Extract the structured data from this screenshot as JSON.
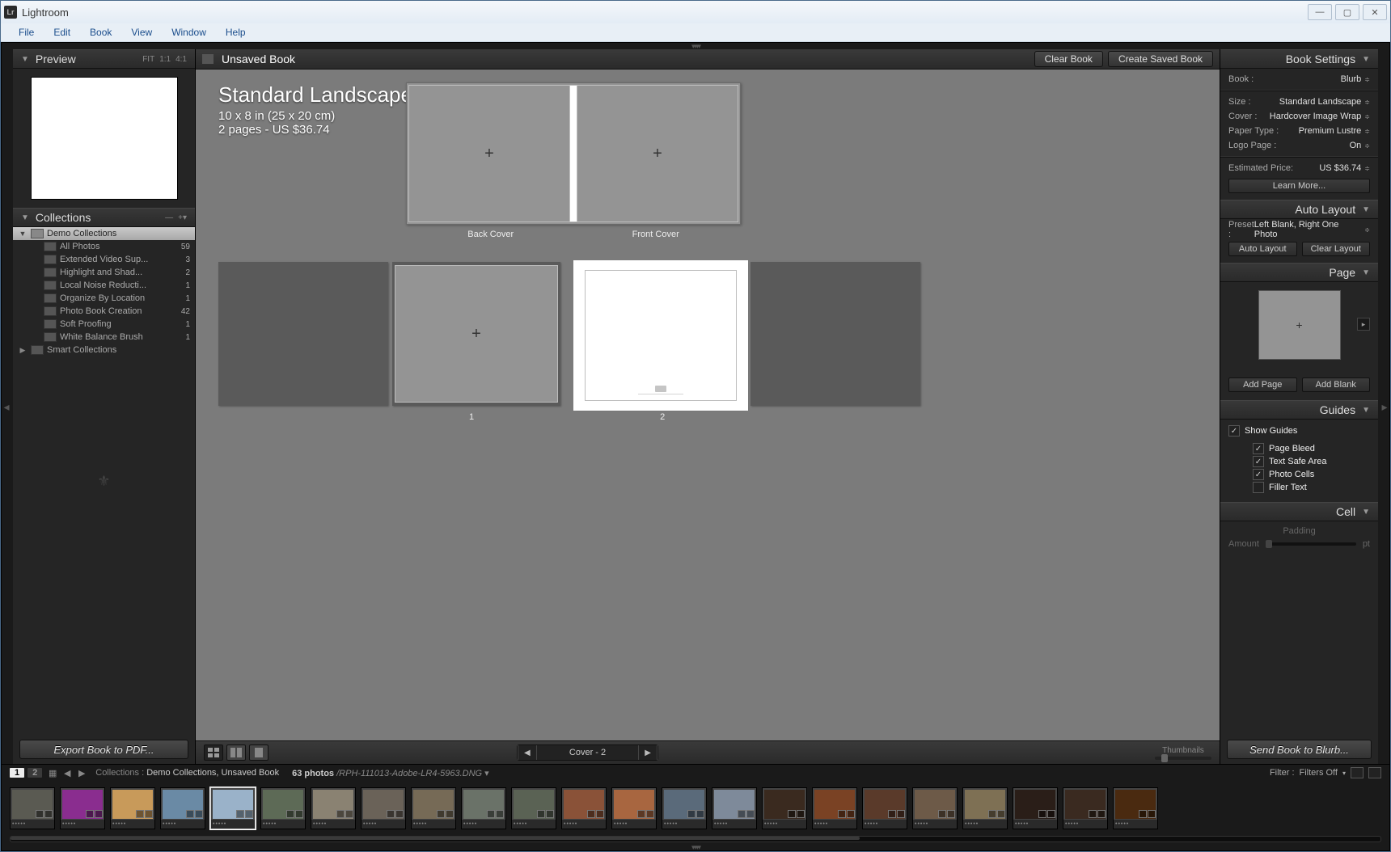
{
  "window": {
    "title": "Lightroom",
    "logo": "Lr"
  },
  "menu": [
    "File",
    "Edit",
    "Book",
    "View",
    "Window",
    "Help"
  ],
  "left": {
    "preview": {
      "label": "Preview",
      "opts": [
        "FIT",
        "1:1",
        "4:1"
      ]
    },
    "collections": {
      "label": "Collections",
      "items": [
        {
          "type": "group",
          "name": "Demo Collections",
          "selected": true,
          "exp": "▼"
        },
        {
          "type": "coll",
          "name": "All Photos",
          "count": 59
        },
        {
          "type": "coll",
          "name": "Extended Video Sup...",
          "count": 3
        },
        {
          "type": "coll",
          "name": "Highlight and Shad...",
          "count": 2
        },
        {
          "type": "coll",
          "name": "Local Noise Reducti...",
          "count": 1
        },
        {
          "type": "coll",
          "name": "Organize By Location",
          "count": 1
        },
        {
          "type": "coll",
          "name": "Photo Book Creation",
          "count": 42
        },
        {
          "type": "coll",
          "name": "Soft Proofing",
          "count": 1
        },
        {
          "type": "coll",
          "name": "White Balance Brush",
          "count": 1
        },
        {
          "type": "group",
          "name": "Smart Collections",
          "exp": "▶"
        }
      ]
    },
    "export": "Export Book to PDF..."
  },
  "center": {
    "title": "Unsaved Book",
    "clear": "Clear Book",
    "save": "Create Saved Book",
    "info": {
      "title": "Standard Landscape",
      "size": "10 x 8 in (25 x 20 cm)",
      "pages": "2 pages - US $36.74"
    },
    "cover_labels": {
      "back": "Back Cover",
      "front": "Front Cover"
    },
    "page_labels": {
      "p1": "1",
      "p2": "2"
    },
    "pager": {
      "label": "Cover - 2"
    },
    "thumbnails": "Thumbnails"
  },
  "right": {
    "book_settings": {
      "label": "Book Settings",
      "rows": [
        {
          "lbl": "Book :",
          "val": "Blurb"
        },
        {
          "lbl": "Size :",
          "val": "Standard Landscape"
        },
        {
          "lbl": "Cover :",
          "val": "Hardcover Image Wrap"
        },
        {
          "lbl": "Paper Type :",
          "val": "Premium Lustre"
        },
        {
          "lbl": "Logo Page :",
          "val": "On"
        }
      ],
      "price": {
        "lbl": "Estimated Price:",
        "val": "US $36.74"
      },
      "learn": "Learn More..."
    },
    "auto_layout": {
      "label": "Auto Layout",
      "preset_lbl": "Preset :",
      "preset_val": "Left Blank, Right One Photo",
      "btn1": "Auto Layout",
      "btn2": "Clear Layout"
    },
    "page": {
      "label": "Page",
      "btn1": "Add Page",
      "btn2": "Add Blank"
    },
    "guides": {
      "label": "Guides",
      "show": "Show Guides",
      "items": [
        {
          "n": "Page Bleed",
          "c": true
        },
        {
          "n": "Text Safe Area",
          "c": true
        },
        {
          "n": "Photo Cells",
          "c": true
        },
        {
          "n": "Filler Text",
          "c": false
        }
      ]
    },
    "cell": {
      "label": "Cell",
      "padding": "Padding",
      "amount": "Amount",
      "unit": "pt"
    },
    "send": "Send Book to Blurb..."
  },
  "filmstrip": {
    "badge1": "1",
    "badge2": "2",
    "path_pre": "Collections : ",
    "path": "Demo Collections, Unsaved Book",
    "count": "63 photos",
    "file": " /RPH-111013-Adobe-LR4-5963.DNG",
    "filter_lbl": "Filter :",
    "filter_val": "Filters Off",
    "thumbs": [
      {
        "c": "#5a5a52"
      },
      {
        "c": "#8a2d8f"
      },
      {
        "c": "#c89a5a"
      },
      {
        "c": "#6a8aa5"
      },
      {
        "c": "#9ab2c9",
        "sel": true
      },
      {
        "c": "#5d6a56"
      },
      {
        "c": "#8a8272"
      },
      {
        "c": "#6a6258"
      },
      {
        "c": "#766a56"
      },
      {
        "c": "#6a7268"
      },
      {
        "c": "#5a6254"
      },
      {
        "c": "#8a5238"
      },
      {
        "c": "#a86640"
      },
      {
        "c": "#5a6a7a"
      },
      {
        "c": "#7e8a9a"
      },
      {
        "c": "#3a2a1f"
      },
      {
        "c": "#7a4224"
      },
      {
        "c": "#5a3a2a"
      },
      {
        "c": "#6d5a48"
      },
      {
        "c": "#7e7054"
      },
      {
        "c": "#2a1e18"
      },
      {
        "c": "#3a2a20"
      },
      {
        "c": "#4a2a10"
      }
    ]
  }
}
